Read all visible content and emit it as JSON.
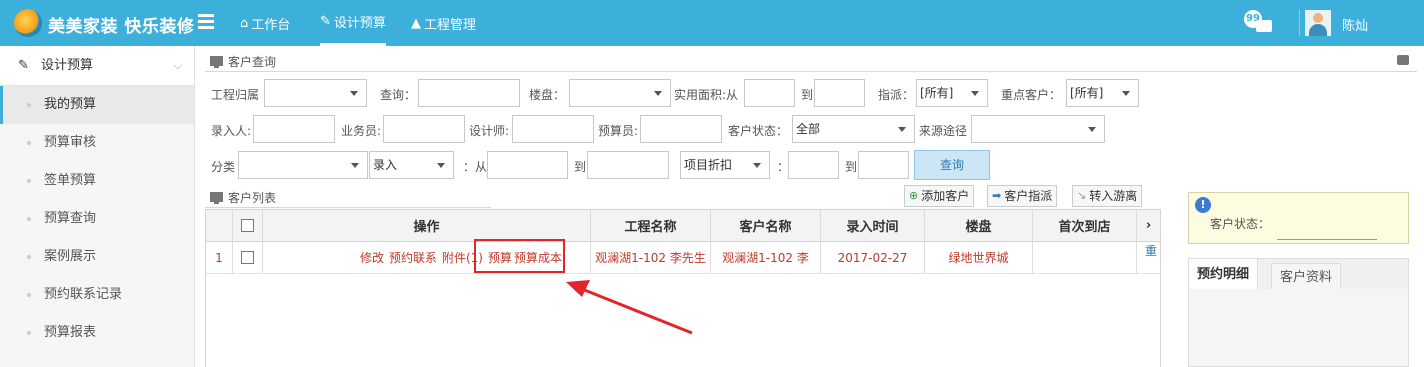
{
  "header": {
    "brand": "美美家装 快乐装修",
    "nav": [
      {
        "icon": "home-icon",
        "label": "工作台"
      },
      {
        "icon": "edit-icon",
        "label": "设计预算"
      },
      {
        "icon": "graduation-cap-icon",
        "label": "工程管理"
      }
    ],
    "message_count": "99",
    "user_name": "陈灿"
  },
  "sidebar": {
    "section": "设计预算",
    "items": [
      {
        "label": "我的预算"
      },
      {
        "label": "预算审核"
      },
      {
        "label": "签单预算"
      },
      {
        "label": "预算查询"
      },
      {
        "label": "案例展示"
      },
      {
        "label": "预约联系记录"
      },
      {
        "label": "预算报表"
      }
    ]
  },
  "query": {
    "title": "客户查询",
    "project_owner_label": "工程归属",
    "search_label": "查询：",
    "estate_label": "楼盘：",
    "area_label": "实用面积:从",
    "area_to_label": "到",
    "assign_label": "指派：",
    "assign_value": "[所有]",
    "key_customer_label": "重点客户：",
    "key_customer_value": "[所有]",
    "entry_person_label": "录入人:",
    "salesman_label": "业务员:",
    "designer_label": "设计师:",
    "budgeter_label": "预算员:",
    "customer_status_label": "客户状态：",
    "customer_status_value": "全部",
    "source_label": "来源途径",
    "category_label": "分类",
    "entry_select": "录入",
    "from_label": "：从",
    "to_label": "到",
    "discount_select": "项目折扣",
    "colon_label": "：",
    "to_label_2": "到",
    "query_button": "查询"
  },
  "list": {
    "title": "客户列表",
    "add_customer": "添加客户",
    "assign_customer": "客户指派",
    "transfer_wander": "转入游离",
    "columns": [
      "操作",
      "工程名称",
      "客户名称",
      "录入时间",
      "楼盘",
      "首次到店",
      "›"
    ],
    "rows": [
      {
        "index": "1",
        "ops": [
          "修改",
          "预约联系",
          "附件(1)",
          "预算",
          "预算成本"
        ],
        "project": "观澜湖1-102 李先生",
        "customer": "观澜湖1-102 李",
        "entry_time": "2017-02-27",
        "estate": "绿地世界城",
        "first_visit": ""
      }
    ],
    "side_link": "重"
  },
  "right_panel": {
    "status_label": "客户状态：",
    "tabs": [
      "预约明细",
      "客户资料"
    ]
  }
}
